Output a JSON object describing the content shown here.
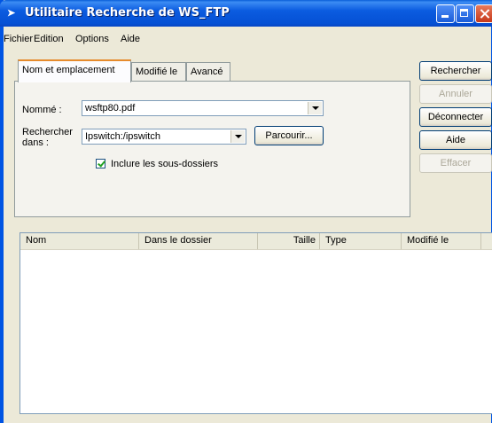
{
  "window": {
    "title": "Utilitaire Recherche de WS_FTP"
  },
  "menu": [
    "Fichier",
    "Edition",
    "Options",
    "Aide"
  ],
  "tabs": [
    "Nom et emplacement",
    "Modifié le",
    "Avancé"
  ],
  "form": {
    "named_label": "Nommé :",
    "named_value": "wsftp80.pdf",
    "search_in_label_1": "Rechercher",
    "search_in_label_2": "dans :",
    "search_in_value": "Ipswitch:/ipswitch",
    "browse_label": "Parcourir...",
    "include_subfolders_label": "Inclure les sous-dossiers",
    "include_subfolders_checked": true
  },
  "buttons": {
    "search": "Rechercher",
    "cancel": "Annuler",
    "disconnect": "Déconnecter",
    "help": "Aide",
    "clear": "Effacer"
  },
  "results": {
    "columns": [
      "Nom",
      "Dans le dossier",
      "Taille",
      "Type",
      "Modifié le"
    ],
    "rows": []
  }
}
